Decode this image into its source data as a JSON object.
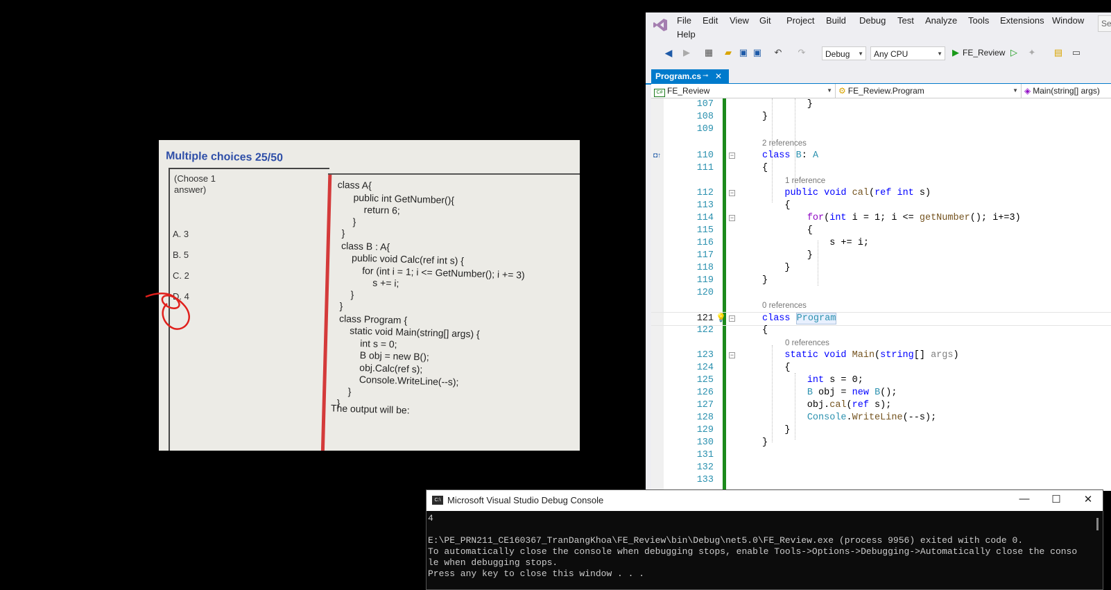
{
  "photo": {
    "title": "Multiple choices 25/50",
    "choose": "(Choose 1\nanswer)",
    "options": [
      "A. 3",
      "B. 5",
      "C. 2",
      "D. 4"
    ],
    "code": "class A{\n      public int GetNumber(){\n          return 6;\n      }\n  }\n  class B : A{\n      public void Calc(ref int s) {\n          for (int i = 1; i <= GetNumber(); i += 3)\n              s += i;\n      }\n  }\n  class Program {\n      static void Main(string[] args) {\n          int s = 0;\n          B obj = new B();\n          obj.Calc(ref s);\n          Console.WriteLine(--s);\n      }\n  }",
    "output_label": "The output will be:"
  },
  "vs": {
    "menu": [
      "File",
      "Edit",
      "View",
      "Git",
      "Project",
      "Build",
      "Debug",
      "Test",
      "Analyze",
      "Tools",
      "Extensions",
      "Window",
      "Help"
    ],
    "search_placeholder": "Sea",
    "toolbar": {
      "config": "Debug",
      "platform": "Any CPU",
      "run_target": "FE_Review"
    },
    "tab": {
      "label": "Program.cs",
      "pin": "⊸",
      "close": "✕"
    },
    "nav": {
      "project": "FE_Review",
      "type": "FE_Review.Program",
      "member": "Main(string[] args)"
    },
    "refs": {
      "class_b": "2 references",
      "cal": "1 reference",
      "program": "0 references",
      "main": "0 references"
    },
    "line_numbers": [
      "107",
      "108",
      "109",
      "110",
      "111",
      "112",
      "113",
      "114",
      "115",
      "116",
      "117",
      "118",
      "119",
      "120",
      "121",
      "122",
      "123",
      "124",
      "125",
      "126",
      "127",
      "128",
      "129",
      "130",
      "131",
      "132",
      "133"
    ]
  },
  "console": {
    "title": "Microsoft Visual Studio Debug Console",
    "icon": "C:\\",
    "output": "4\n\nE:\\PE_PRN211_CE160367_TranDangKhoa\\FE_Review\\bin\\Debug\\net5.0\\FE_Review.exe (process 9956) exited with code 0.\nTo automatically close the console when debugging stops, enable Tools->Options->Debugging->Automatically close the conso\nle when debugging stops.\nPress any key to close this window . . ."
  }
}
